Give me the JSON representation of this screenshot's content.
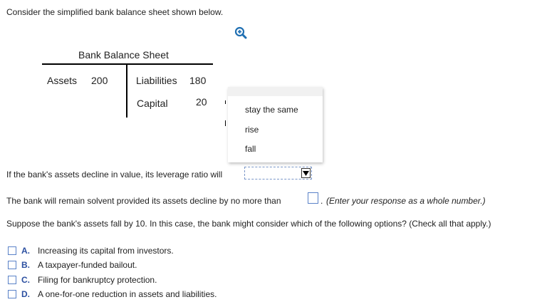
{
  "intro": "Consider the simplified bank balance sheet shown below.",
  "zoom_icon": "zoom-in-icon",
  "balance_sheet": {
    "title": "Bank Balance Sheet",
    "assets_label": "Assets",
    "assets_value": "200",
    "liabilities_label": "Liabilities",
    "liabilities_value": "180",
    "capital_label": "Capital",
    "capital_value": "20"
  },
  "dropdown_menu": {
    "options": [
      "stay the same",
      "rise",
      "fall"
    ]
  },
  "leverage_question": {
    "text": "If the bank's assets decline in value, its leverage ratio will",
    "selected": ""
  },
  "solvency_question": {
    "text": "The bank will remain solvent provided its assets decline by no more than",
    "value": "",
    "after": ".",
    "hint": "(Enter your response as a whole number.)"
  },
  "options_question": {
    "text": "Suppose the bank's assets fall by 10. In this case, the bank might consider which of the following options? (Check all that apply.)",
    "choices": [
      {
        "letter": "A.",
        "text": "Increasing its capital from investors."
      },
      {
        "letter": "B.",
        "text": "A taxpayer-funded bailout."
      },
      {
        "letter": "C.",
        "text": "Filing for bankruptcy protection."
      },
      {
        "letter": "D.",
        "text": "A one-for-one reduction in assets and liabilities."
      }
    ]
  },
  "colors": {
    "accent": "#2b4fa0",
    "checkbox_border": "#5a82c8",
    "zoom_icon": "#1f6fb2"
  }
}
